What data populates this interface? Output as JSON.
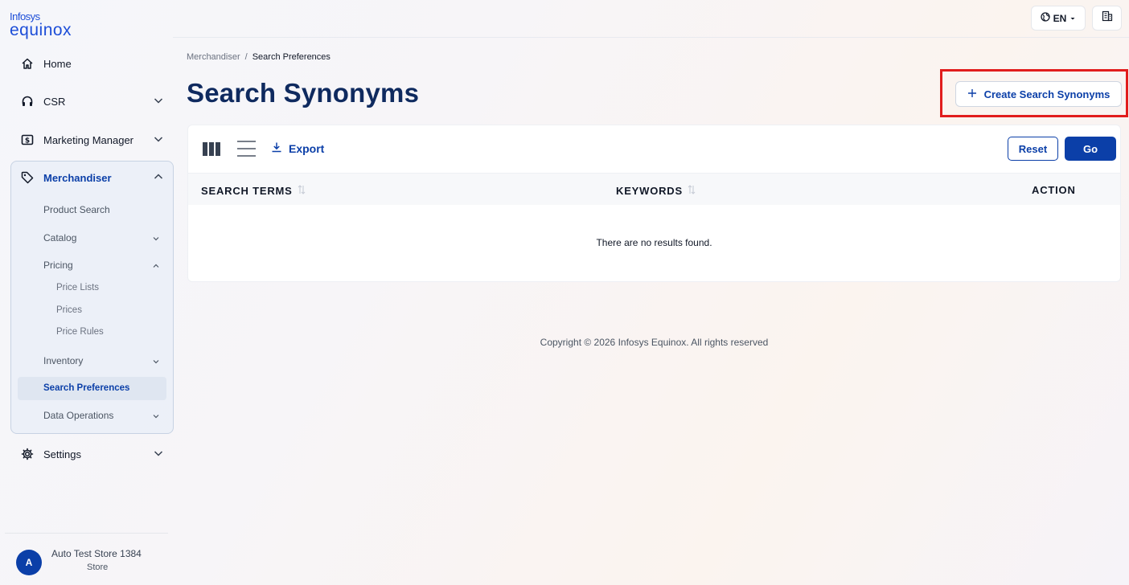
{
  "logo": {
    "line1": "Infosys",
    "line2": "equinox"
  },
  "nav": {
    "home": "Home",
    "csr": "CSR",
    "marketing": "Marketing Manager",
    "merchandiser": "Merchandiser",
    "settings": "Settings"
  },
  "merch_sub": {
    "product_search": "Product Search",
    "catalog": "Catalog",
    "pricing": "Pricing",
    "price_lists": "Price Lists",
    "prices": "Prices",
    "price_rules": "Price Rules",
    "inventory": "Inventory",
    "search_preferences": "Search Preferences",
    "data_operations": "Data Operations"
  },
  "user": {
    "initial": "A",
    "name": "Auto Test Store 1384",
    "role": "Store"
  },
  "topbar": {
    "language": "EN"
  },
  "breadcrumb": {
    "parent": "Merchandiser",
    "separator": "/",
    "current": "Search Preferences"
  },
  "page": {
    "title": "Search Synonyms",
    "create_label": "Create Search Synonyms"
  },
  "toolbar": {
    "export_label": "Export",
    "reset_label": "Reset",
    "go_label": "Go"
  },
  "table": {
    "columns": [
      "SEARCH TERMS",
      "KEYWORDS",
      "ACTION"
    ],
    "empty_message": "There are no results found."
  },
  "footer": {
    "copyright": "Copyright © 2026 Infosys Equinox. All rights reserved"
  },
  "colors": {
    "primary": "#0b3fa8",
    "title": "#0f2a5f",
    "highlight": "#e11d1d"
  }
}
